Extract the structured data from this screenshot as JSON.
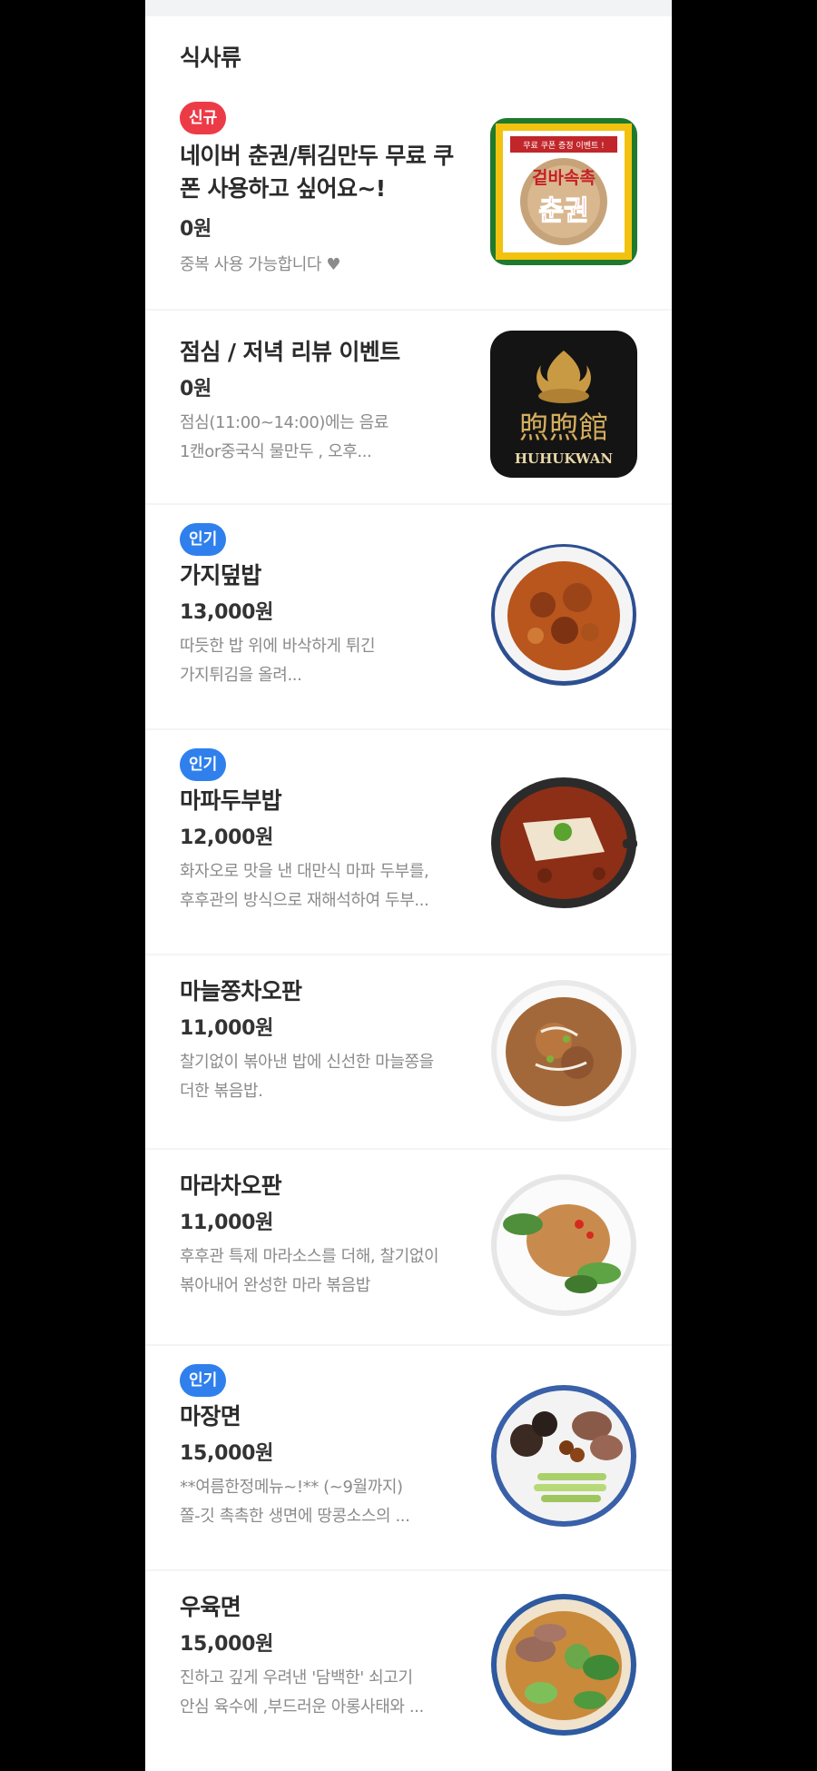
{
  "section": {
    "title": "식사류"
  },
  "items": [
    {
      "badge": "신규",
      "name_line1": "네이버 춘권/튀김만두 무료 쿠",
      "name_line2": "폰 사용하고 싶어요~!",
      "price": "0원",
      "desc_line1": "중복 사용 가능합니다 ♥"
    },
    {
      "name": "점심 / 저녁 리뷰 이벤트",
      "price": "0원",
      "desc_line1": "점심(11:00~14:00)에는 음료",
      "desc_line2": "1캔or중국식 물만두 , 오후...",
      "image_text": {
        "line1": "煦煦館",
        "line2": "HUHUKWAN"
      }
    },
    {
      "badge": "인기",
      "name": "가지덮밥",
      "price": "13,000원",
      "desc_line1": "따듯한 밥 위에 바삭하게 튀긴",
      "desc_line2": "가지튀김을 올려..."
    },
    {
      "badge": "인기",
      "name": "마파두부밥",
      "price": "12,000원",
      "desc_line1": "화자오로 맛을 낸 대만식 마파 두부를,",
      "desc_line2": "후후관의 방식으로 재해석하여 두부..."
    },
    {
      "name": "마늘쫑차오판",
      "price": "11,000원",
      "desc_line1": "찰기없이 볶아낸 밥에 신선한 마늘쫑을",
      "desc_line2": "더한 볶음밥."
    },
    {
      "name": "마라차오판",
      "price": "11,000원",
      "desc_line1": "후후관 특제 마라소스를 더해, 찰기없이",
      "desc_line2": "볶아내어 완성한 마라 볶음밥"
    },
    {
      "badge": "인기",
      "name": "마장면",
      "price": "15,000원",
      "desc_line1": "**여름한정메뉴~!** (~9월까지)",
      "desc_line2": "쫄-깃 촉촉한 생면에 땅콩소스의 ..."
    },
    {
      "name": "우육면",
      "price": "15,000원",
      "desc_line1": "진하고 깊게 우려낸 '담백한' 쇠고기",
      "desc_line2": "안심 육수에 ,부드러운 아롱사태와 ..."
    }
  ],
  "coupon_image": {
    "top": "무료 쿠폰 증정 이벤트 !",
    "middle": "겉바속촉",
    "main": "춘권"
  },
  "colors": {
    "badge_new": "#ec3b47",
    "badge_popular": "#2f80ed"
  },
  "icons": [
    "food-photo",
    "logo-image"
  ]
}
